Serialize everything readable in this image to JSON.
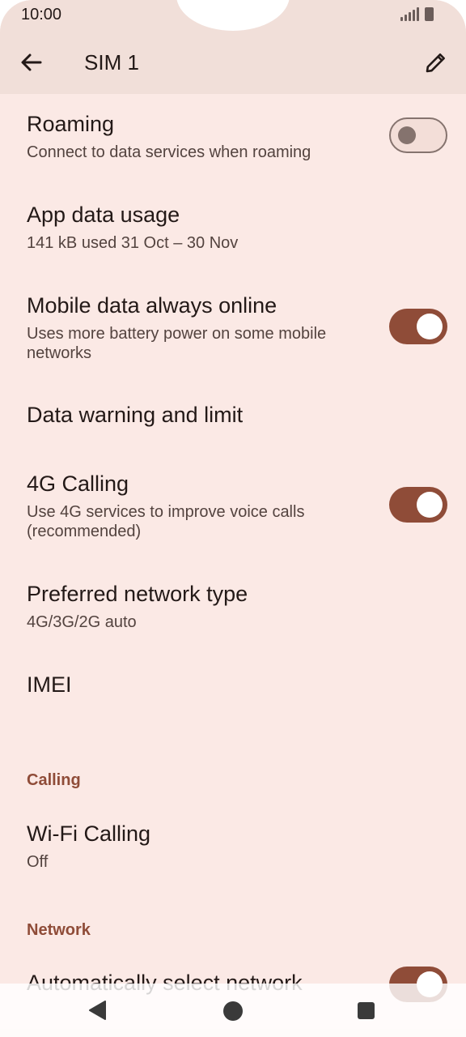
{
  "status_bar": {
    "time": "10:00",
    "icons": [
      "signal-icon",
      "battery-icon"
    ]
  },
  "header": {
    "title": "SIM 1",
    "back_icon": "arrow-left-icon",
    "edit_icon": "pencil-icon"
  },
  "settings": {
    "roaming": {
      "title": "Roaming",
      "subtitle": "Connect to data services when roaming",
      "enabled": false
    },
    "app_data_usage": {
      "title": "App data usage",
      "subtitle": "141 kB used 31 Oct – 30 Nov"
    },
    "mobile_data_always_online": {
      "title": "Mobile data always online",
      "subtitle": "Uses more battery power on some mobile networks",
      "enabled": true
    },
    "data_warning": {
      "title": "Data warning and limit"
    },
    "calling_4g": {
      "title": "4G Calling",
      "subtitle": "Use 4G services to improve voice calls (recommended)",
      "enabled": true
    },
    "preferred_network": {
      "title": "Preferred network type",
      "subtitle": "4G/3G/2G auto"
    },
    "imei": {
      "title": "IMEI"
    },
    "calling_section": "Calling",
    "wifi_calling": {
      "title": "Wi-Fi Calling",
      "subtitle": "Off"
    },
    "network_section": "Network",
    "auto_select_network": {
      "title": "Automatically select network",
      "enabled": true
    }
  },
  "nav_bar": {
    "icons": [
      "back-triangle-icon",
      "home-circle-icon",
      "recents-square-icon"
    ]
  },
  "colors": {
    "accent": "#8f4c38",
    "background": "#fbe9e5",
    "header_background": "#f1dfd9"
  }
}
